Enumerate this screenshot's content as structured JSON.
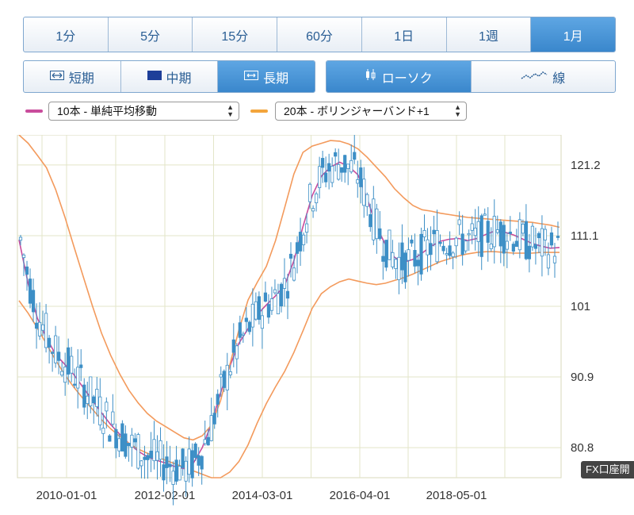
{
  "timeframes": [
    {
      "label": "1分",
      "active": false
    },
    {
      "label": "5分",
      "active": false
    },
    {
      "label": "15分",
      "active": false
    },
    {
      "label": "60分",
      "active": false
    },
    {
      "label": "1日",
      "active": false
    },
    {
      "label": "1週",
      "active": false
    },
    {
      "label": "1月",
      "active": true
    }
  ],
  "term_buttons": [
    {
      "label": "短期",
      "icon": "short-term-icon",
      "active": false
    },
    {
      "label": "中期",
      "icon": "mid-term-icon",
      "active": false
    },
    {
      "label": "長期",
      "icon": "long-term-icon",
      "active": true
    }
  ],
  "chart_type_buttons": [
    {
      "label": "ローソク",
      "icon": "candlestick-icon",
      "active": true
    },
    {
      "label": "線",
      "icon": "line-chart-icon",
      "active": false
    }
  ],
  "indicators": {
    "ma": {
      "label": "10本 - 単純平均移動",
      "color": "#c94c9c"
    },
    "bb": {
      "label": "20本 - ボリンジャーバンド+1",
      "color": "#f3a53c"
    }
  },
  "fx_tab_label": "FX口座開設",
  "colors": {
    "candle": "#3d8fc6",
    "ma": "#c94c9c",
    "band": "#f39a5c",
    "grid": "#e3e5c8",
    "accent": "#3a87cc"
  },
  "chart_data": {
    "type": "line",
    "title": "",
    "x_tick_labels": [
      "2010-01-01",
      "2012-02-01",
      "2014-03-01",
      "2016-04-01",
      "2018-05-01"
    ],
    "y_tick_labels": [
      "121.2",
      "111.1",
      "101",
      "90.9",
      "80.8"
    ],
    "ylim": [
      76.5,
      125.5
    ],
    "grid": true,
    "series": [
      {
        "values": [
          110.5,
          104.2,
          99.3,
          96.5,
          94.1,
          92.7,
          91.2,
          89.4,
          87.6,
          85.8,
          84.1,
          82.7,
          81.4,
          80.3,
          79.5,
          79.0,
          78.6,
          78.1,
          77.8,
          78.5,
          80.8,
          84.2,
          88.6,
          92.4,
          95.7,
          97.8,
          99.8,
          101.2,
          102.5,
          104.0,
          107.5,
          112.4,
          116.8,
          119.6,
          120.9,
          121.6,
          121.0,
          119.8,
          116.4,
          112.5,
          109.8,
          108.0,
          107.3,
          107.7,
          108.6,
          109.6,
          110.3,
          110.6,
          110.7,
          110.4,
          110.7,
          111.3,
          111.8,
          111.6,
          111.2,
          110.6,
          110.0,
          109.6,
          109.3,
          109.4
        ]
      },
      {
        "values": [
          125.5,
          124.3,
          122.6,
          120.8,
          117.7,
          113.8,
          109.5,
          105.3,
          101.1,
          97.2,
          94.0,
          91.3,
          89.0,
          87.2,
          85.7,
          84.6,
          83.8,
          83.0,
          82.2,
          81.9,
          82.5,
          84.0,
          87.5,
          92.6,
          97.6,
          101.9,
          104.4,
          106.7,
          110.4,
          115.1,
          119.9,
          123.0,
          123.9,
          124.3,
          124.7,
          124.6,
          124.2,
          123.5,
          122.3,
          120.9,
          119.5,
          117.8,
          116.5,
          115.4,
          114.8,
          114.6,
          114.3,
          114.1,
          113.9,
          113.7,
          113.6,
          113.5,
          113.4,
          113.3,
          113.2,
          113.1,
          113.0,
          112.8,
          112.6,
          112.3
        ]
      },
      {
        "values": [
          101.8,
          100.0,
          97.9,
          95.6,
          93.3,
          91.2,
          89.4,
          87.8,
          86.3,
          84.8,
          83.5,
          82.4,
          81.4,
          80.6,
          80.0,
          79.5,
          79.0,
          78.5,
          78.0,
          77.5,
          77.0,
          76.5,
          76.5,
          77.3,
          78.8,
          81.2,
          84.3,
          87.1,
          89.5,
          91.7,
          94.4,
          97.5,
          100.7,
          102.8,
          103.8,
          104.5,
          104.9,
          104.6,
          104.3,
          104.1,
          104.3,
          104.7,
          105.1,
          105.6,
          106.2,
          106.8,
          107.4,
          107.8,
          108.2,
          108.5,
          108.7,
          108.8,
          108.8,
          108.7,
          108.6,
          108.6,
          108.6,
          108.7,
          108.7,
          108.7
        ]
      }
    ]
  }
}
